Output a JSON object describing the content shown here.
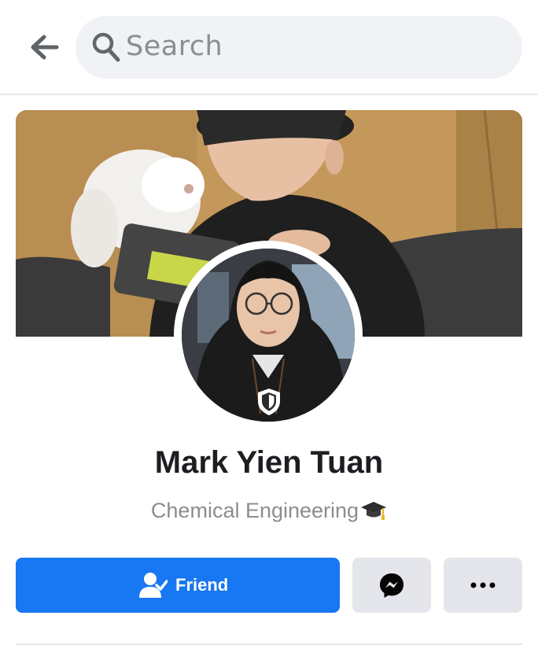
{
  "search": {
    "placeholder": "Search"
  },
  "profile": {
    "name": "Mark Yien Tuan",
    "bio": "Chemical Engineering",
    "bio_emoji": "graduation-cap-icon"
  },
  "actions": {
    "friend_label": "Friend",
    "friend_icon": "user-check-icon",
    "message_icon": "messenger-icon",
    "more_icon": "more-dots-icon"
  },
  "colors": {
    "primary": "#1877f2",
    "secondary_button": "#e4e6eb",
    "search_bg": "#f0f2f5",
    "text_primary": "#1c1e21",
    "text_secondary": "#8a8d91"
  }
}
